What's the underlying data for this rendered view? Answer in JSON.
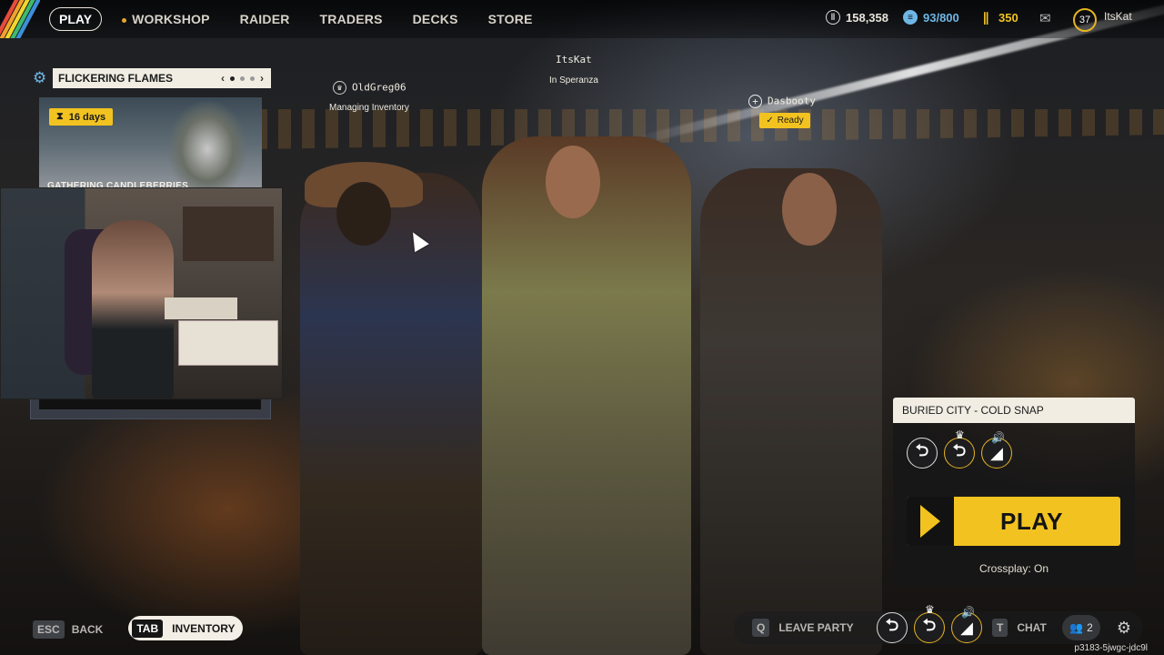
{
  "topbar": {
    "nav": {
      "play": "PLAY",
      "workshop": "WORKSHOP",
      "raider": "RAIDER",
      "traders": "TRADERS",
      "decks": "DECKS",
      "store": "STORE"
    },
    "currencies": {
      "coins": "158,358",
      "capacity": "93/800",
      "premium": "350"
    },
    "level": "37",
    "username": "ItsKat",
    "icons": [
      "coin-icon",
      "stash-icon",
      "premium-currency-icon",
      "mail-icon",
      "level-badge"
    ]
  },
  "event": {
    "title": "FLICKERING FLAMES",
    "days_left": "16 days",
    "card_title": "GATHERING CANDLEBERRIES",
    "page_index": 1,
    "page_count": 3
  },
  "party": {
    "members": [
      {
        "name": "OldGreg06",
        "status": "Managing Inventory"
      },
      {
        "name": "ItsKat",
        "status": "In Speranza"
      },
      {
        "name": "Dasbooty",
        "status": "Ready"
      }
    ]
  },
  "match": {
    "map": "BURIED CITY - COLD SNAP",
    "play_label": "PLAY",
    "crossplay": "Crossplay: On"
  },
  "bottom": {
    "esc_key": "ESC",
    "back": "BACK",
    "tab_key": "TAB",
    "inventory": "INVENTORY",
    "q_key": "Q",
    "leave_party": "LEAVE PARTY",
    "t_key": "T",
    "chat": "CHAT",
    "party_count": "2",
    "session_id": "p3183-5jwgc-jdc9l"
  },
  "colors": {
    "accent": "#f2c320",
    "panel_light": "#f1ede3",
    "stash_blue": "#6fb6e6"
  }
}
